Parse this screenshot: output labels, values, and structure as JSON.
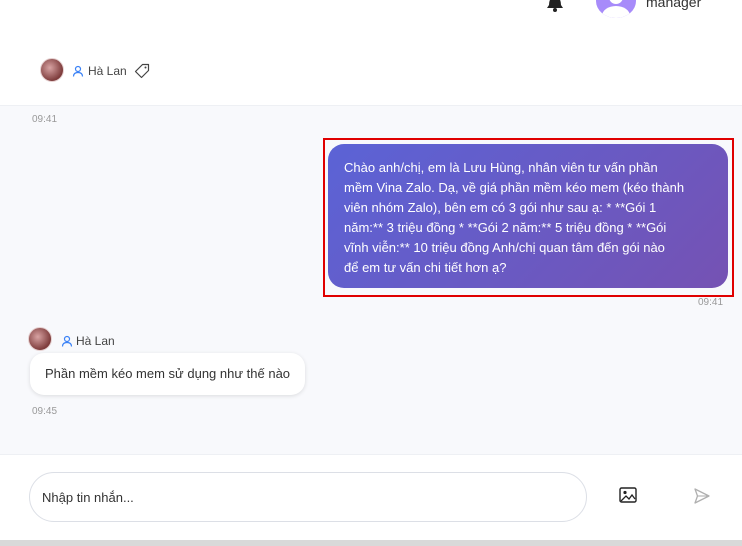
{
  "topbar": {
    "user_role": "manager"
  },
  "chat_header": {
    "contact_name": "Hà Lan"
  },
  "messages": {
    "first_time": "09:41",
    "outgoing": {
      "text": "Chào anh/chị, em là Lưu Hùng, nhân viên tư vấn phần\nmềm Vina Zalo. Dạ, về giá phần mềm kéo mem (kéo thành\nviên nhóm Zalo), bên em có 3 gói như sau ạ: * **Gói 1\nnăm:** 3 triệu đồng * **Gói 2 năm:** 5 triệu đồng * **Gói\nvĩnh viễn:** 10 triệu đồng Anh/chị quan tâm đến gói nào\nđể em tư vấn chi tiết hơn ạ?",
      "time": "09:41"
    },
    "incoming": {
      "sender": "Hà Lan",
      "text": "Phần mềm kéo mem sử dụng như thế nào",
      "time": "09:45"
    }
  },
  "composer": {
    "placeholder": "Nhập tin nhắn..."
  },
  "colors": {
    "accent": "#6a5acd",
    "highlight": "#e00000"
  },
  "icons": [
    "bell-icon",
    "user-avatar-icon",
    "user-icon",
    "tag-icon",
    "image-icon",
    "send-icon"
  ]
}
